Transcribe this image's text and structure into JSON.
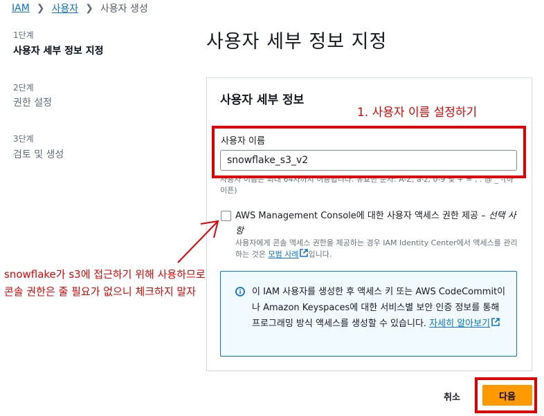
{
  "breadcrumb": {
    "root": "IAM",
    "users": "사용자",
    "current": "사용자 생성"
  },
  "steps": [
    {
      "num": "1단계",
      "title": "사용자 세부 정보 지정"
    },
    {
      "num": "2단계",
      "title": "권한 설정"
    },
    {
      "num": "3단계",
      "title": "검토 및 생성"
    }
  ],
  "page_title": "사용자 세부 정보 지정",
  "panel": {
    "title": "사용자 세부 정보",
    "username_label": "사용자 이름",
    "username_value": "snowflake_s3_v2",
    "username_hint": "사용자 이름은 최대 64자까지 허용됩니다. 유효한 문자: A-Z, a-z, 0-9 및 + = , . @ _ -(하이픈)",
    "console_access_label": "AWS Management Console에 대한 사용자 액세스 권한 제공 –",
    "console_access_optional": "선택 사항",
    "console_access_desc": "사용자에게 콘솔 액세스 권한을 제공하는 경우 IAM Identity Center에서 액세스를 관리하는 것은",
    "best_practice_link": "모범 사례",
    "desc_suffix": "입니다.",
    "info_text": "이 IAM 사용자를 생성한 후 액세스 키 또는 AWS CodeCommit이나 Amazon Keyspaces에 대한 서비스별 보안 인증 정보를 통해 프로그래밍 방식 액세스를 생성할 수 있습니다.",
    "learn_more_link": "자세히 알아보기"
  },
  "footer": {
    "cancel": "취소",
    "next": "다음"
  },
  "annotations": {
    "step1": "1. 사용자 이름 설정하기",
    "note_line1": "snowflake가 s3에 접근하기 위해 사용하므로",
    "note_line2": "콘솔 권한은 줄 필요가 없으니 체크하지 말자"
  },
  "colors": {
    "link": "#0972d3",
    "primary": "#ff9900",
    "annotation": "#e10000",
    "info_bg": "#f1faff"
  }
}
